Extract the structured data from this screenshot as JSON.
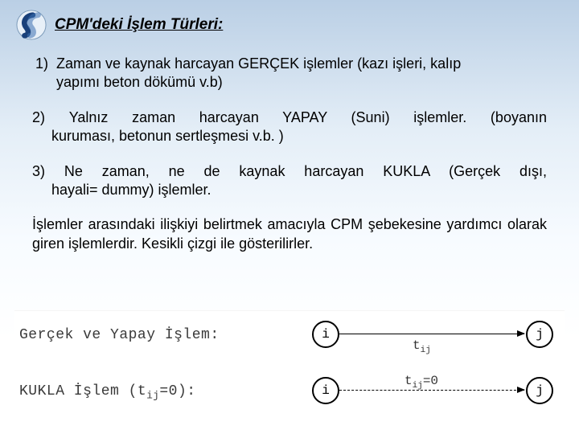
{
  "title": "CPM'deki İşlem Türleri:",
  "items": [
    {
      "num": "1)",
      "line1": "Zaman ve kaynak harcayan GERÇEK işlemler (kazı işleri, kalıp",
      "line2": "yapımı beton dökümü v.b)"
    },
    {
      "num": "2)",
      "line1_pre": "Yalnız zaman harcayan YAPAY (Suni) işlemler. (boyanın",
      "line2": "kuruması, betonun sertleşmesi v.b. )"
    },
    {
      "num": "3)",
      "line1_pre": "Ne zaman, ne de kaynak harcayan KUKLA (Gerçek dışı,",
      "line2": "hayali= dummy) işlemler."
    }
  ],
  "paragraph": "İşlemler arasındaki ilişkiyi belirtmek amacıyla CPM şebekesine yardımcı olarak giren işlemlerdir. Kesikli çizgi ile gösterilirler.",
  "diagram": {
    "row1_label": "Gerçek ve Yapay İşlem:",
    "row2_label_pre": "KUKLA İşlem (t",
    "row2_label_sub": "ij",
    "row2_label_post": "=0):",
    "node_i": "i",
    "node_j": "j",
    "edge_t": "t",
    "edge_sub": "ij",
    "edge_eq": "=0"
  }
}
